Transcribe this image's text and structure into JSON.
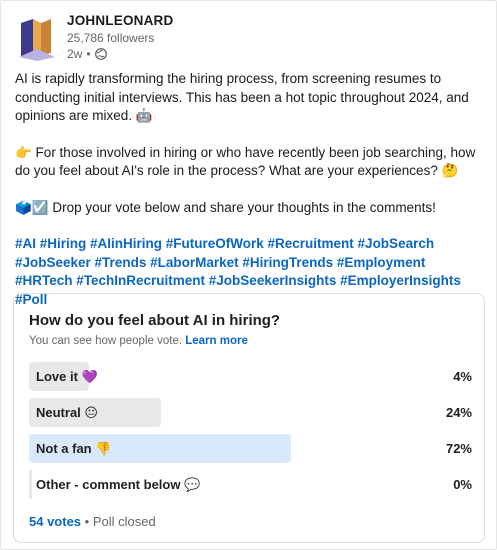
{
  "post": {
    "author": "JOHNLEONARD",
    "followers": "25,786 followers",
    "age": "2w",
    "visibility_icon": "globe-icon",
    "paragraphs": [
      "AI is rapidly transforming the hiring process, from screening resumes to conducting initial interviews. This has been a hot topic throughout 2024, and opinions are mixed. 🤖",
      "👉 For those involved in hiring or who have recently been job searching, how do you feel about AI's role in the process? What are your experiences? 🤔",
      "🗳️☑️ Drop your vote below and share your thoughts in the comments!"
    ],
    "hashtags": "#AI #Hiring #AIinHiring #FutureOfWork #Recruitment #JobSearch #JobSeeker #Trends #LaborMarket #HiringTrends #Employment #HRTech #TechInRecruitment #JobSeekerInsights #EmployerInsights #Poll"
  },
  "poll": {
    "question": "How do you feel about AI in hiring?",
    "subtitle": "You can see how people vote.",
    "learn_more": "Learn more",
    "options": [
      {
        "label": "Love it 💜",
        "percent": "4%",
        "share": 0.04
      },
      {
        "label": "Neutral 😐",
        "percent": "24%",
        "share": 0.24
      },
      {
        "label": "Not a fan 👎",
        "percent": "72%",
        "share": 0.72
      },
      {
        "label": "Other - comment below 💬",
        "percent": "0%",
        "share": 0.0
      }
    ],
    "votes": "54 votes",
    "status": "Poll closed"
  },
  "colors": {
    "accent": "#0a66c2",
    "winner_bar": "#d9e8fb",
    "bar": "#e8e8e8"
  }
}
